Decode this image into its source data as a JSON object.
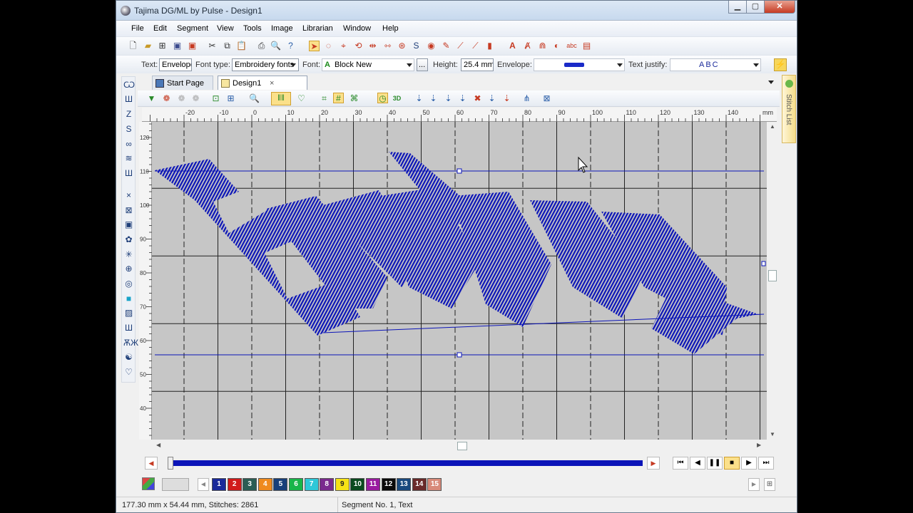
{
  "window": {
    "title": "Tajima DG/ML by Pulse - Design1"
  },
  "menu": [
    "File",
    "Edit",
    "Segment",
    "View",
    "Tools",
    "Image",
    "Librarian",
    "Window",
    "Help"
  ],
  "text_toolbar": {
    "text_label": "Text:",
    "text_value": "Envelope",
    "font_type_label": "Font type:",
    "font_type_value": "Embroidery fonts",
    "font_label": "Font:",
    "font_value": "Block New",
    "browse_label": "...",
    "height_label": "Height:",
    "height_value": "25.4 mm",
    "envelope_label": "Envelope:",
    "text_justify_label": "Text justify:",
    "text_justify_value": "ABC"
  },
  "tabs": [
    {
      "label": "Start Page",
      "active": false
    },
    {
      "label": "Design1",
      "active": true,
      "close": "×"
    }
  ],
  "side_panel": {
    "label": "Stitch List"
  },
  "ruler": {
    "h_ticks": [
      -20,
      -10,
      0,
      10,
      20,
      30,
      40,
      50,
      60,
      70,
      80,
      90,
      100,
      110,
      120,
      130,
      140
    ],
    "h_unit": "mm",
    "v_ticks": [
      120,
      110,
      100,
      90,
      80,
      70,
      60,
      50,
      40
    ]
  },
  "color_palette": [
    {
      "n": "1",
      "c": "#1a2a9a"
    },
    {
      "n": "2",
      "c": "#d11b1b"
    },
    {
      "n": "3",
      "c": "#2b5d54"
    },
    {
      "n": "4",
      "c": "#ef8a1e"
    },
    {
      "n": "5",
      "c": "#173f7a"
    },
    {
      "n": "6",
      "c": "#18b54a"
    },
    {
      "n": "7",
      "c": "#2ec8d8"
    },
    {
      "n": "8",
      "c": "#7a2a8e"
    },
    {
      "n": "9",
      "c": "#f6e316"
    },
    {
      "n": "10",
      "c": "#0a4a1e"
    },
    {
      "n": "11",
      "c": "#9a1aa0"
    },
    {
      "n": "12",
      "c": "#0a0a0a"
    },
    {
      "n": "13",
      "c": "#1a4a7e"
    },
    {
      "n": "14",
      "c": "#6a2a2a"
    },
    {
      "n": "15",
      "c": "#d88a7a"
    }
  ],
  "status": {
    "dimensions": "177.30 mm x 54.44 mm, Stitches: 2861",
    "segment": "Segment No. 1, Text"
  },
  "colors": {
    "stitch": "#0b14b8",
    "canvas": "#c6c6c6"
  }
}
